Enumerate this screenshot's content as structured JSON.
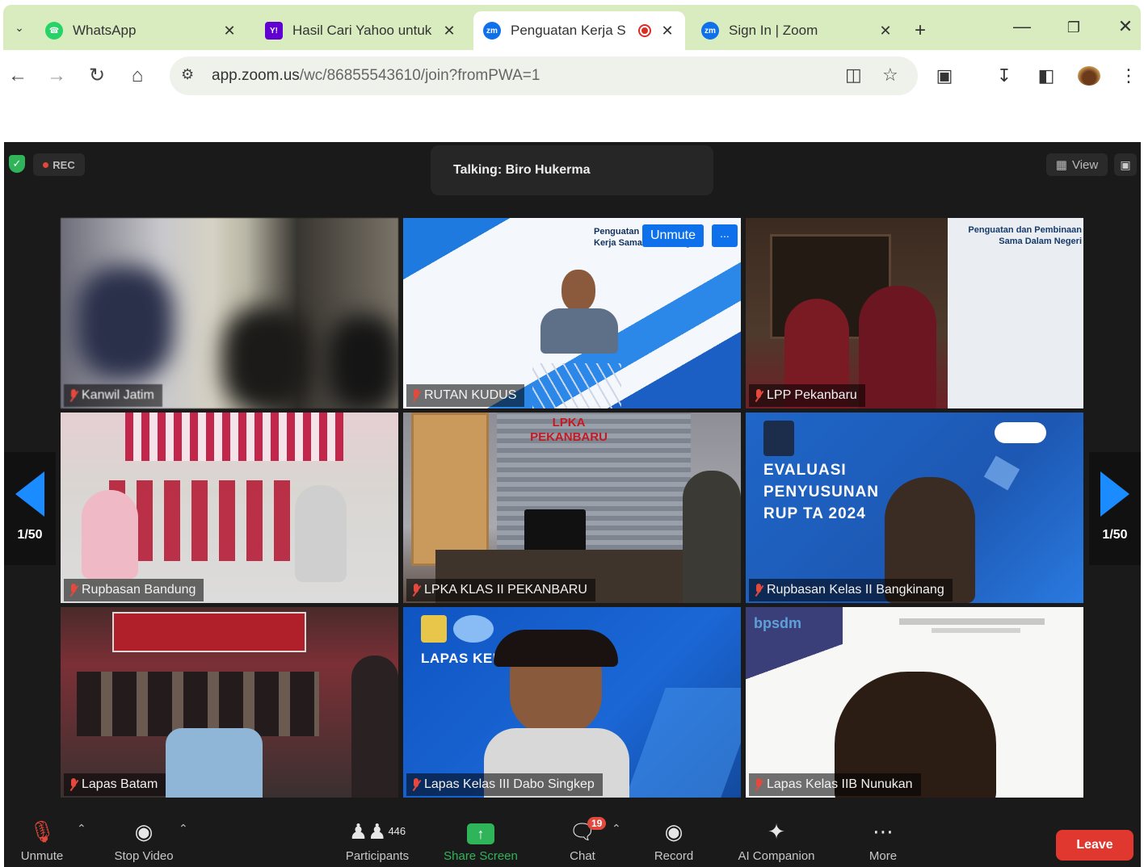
{
  "browser": {
    "tabs": [
      {
        "title": "WhatsApp",
        "favicon_color": "#25d366"
      },
      {
        "title": "Hasil Cari Yahoo untuk",
        "favicon_color": "#6001d2"
      },
      {
        "title": "Penguatan Kerja S",
        "favicon_color": "#0e71eb"
      },
      {
        "title": "Sign In | Zoom",
        "favicon_color": "#0e71eb"
      }
    ],
    "url_host": "app.zoom.us",
    "url_path": "/wc/86855543610/join?fromPWA=1"
  },
  "meeting": {
    "rec_label": "REC",
    "talking": "Talking: Biro Hukerma",
    "view_label": "View",
    "page_indicator": "1/50",
    "unmute_chip": "Unmute",
    "more_chip": "...",
    "participants": [
      "Kanwil Jatim",
      "RUTAN KUDUS",
      "LPP Pekanbaru",
      "Rupbasan Bandung",
      "LPKA KLAS II PEKANBARU",
      "Rupbasan Kelas II Bangkinang",
      "Lapas Batam",
      "Lapas Kelas III Dabo Singkep",
      "Lapas Kelas IIB Nunukan"
    ],
    "tile_texts": {
      "rutan_slide_title": "Penguatan\nKerja Sama Dalam Negeri",
      "lpp_slide_title": "Penguatan dan Pembinaan\nSama Dalam Negeri",
      "lpka_wall": "LPKA\nPEKANBARU",
      "evaluasi": "EVALUASI\nPENYUSUNAN\nRUP TA 2024",
      "lapas_slide": "LAPAS KEL     NGKEP",
      "bpsdm": "bpsdm"
    }
  },
  "controls": {
    "unmute": "Unmute",
    "stop_video": "Stop Video",
    "participants": "Participants",
    "participants_count": "446",
    "share_screen": "Share Screen",
    "chat": "Chat",
    "chat_badge": "19",
    "record": "Record",
    "ai_companion": "AI Companion",
    "more": "More",
    "leave": "Leave"
  },
  "colors": {
    "accent_blue": "#0e71eb",
    "leave_red": "#e0372e",
    "share_green": "#2fb45a",
    "pager_blue": "#1a8cff"
  }
}
